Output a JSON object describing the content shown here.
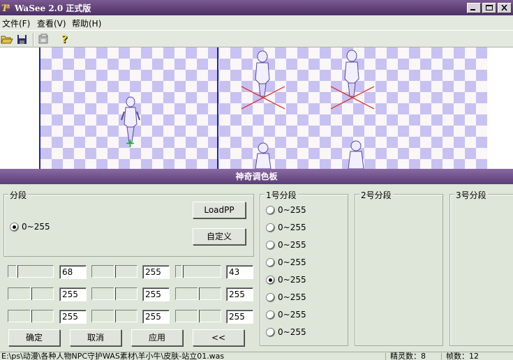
{
  "window": {
    "title": "WaSee 2.0 正式版"
  },
  "menu": [
    {
      "label": "文件(F)"
    },
    {
      "label": "查看(V)"
    },
    {
      "label": "帮助(H)"
    }
  ],
  "toolbar": {
    "icons": [
      "open-folder-icon",
      "save-icon",
      "export-icon",
      "help-icon"
    ]
  },
  "palette": {
    "title": "神奇调色板",
    "segments_group_label": "分段",
    "segment_option": "0~255",
    "loadpp_label": "LoadPP",
    "custom_label": "自定义",
    "rows": [
      {
        "v1": "68",
        "v2": "255",
        "v3": "43"
      },
      {
        "v1": "255",
        "v2": "255",
        "v3": "255"
      },
      {
        "v1": "255",
        "v2": "255",
        "v3": "255"
      }
    ],
    "ok_label": "确定",
    "cancel_label": "取消",
    "apply_label": "应用",
    "back_label": "<<",
    "seg1_label": "1号分段",
    "seg1_options": [
      "0~255",
      "0~255",
      "0~255",
      "0~255",
      "0~255",
      "0~255",
      "0~255",
      "0~255"
    ],
    "seg1_selected_index": 4,
    "seg2_label": "2号分段",
    "seg3_label": "3号分段"
  },
  "status": {
    "path": "E:\\ps\\动漫\\各种人物NPC守护WAS素材\\羊小牛\\皮肤-站立01.was",
    "sprites": "精灵数：8",
    "frames": "帧数：12"
  }
}
